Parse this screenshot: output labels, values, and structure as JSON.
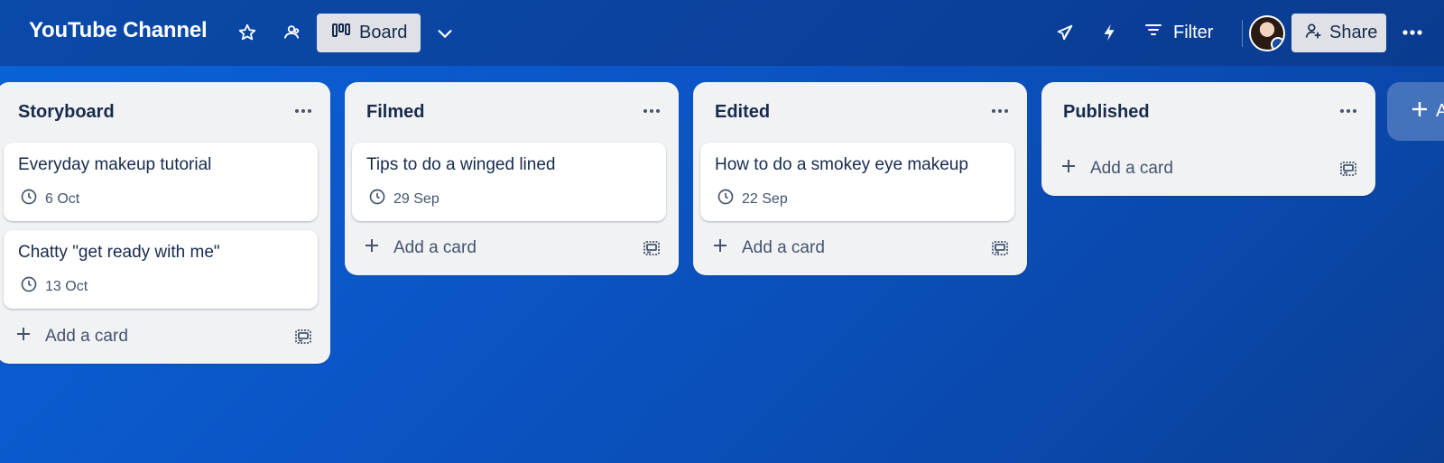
{
  "header": {
    "board_title": "YouTube Channel",
    "view_label": "Board",
    "filter_label": "Filter",
    "share_label": "Share"
  },
  "lists": [
    {
      "title": "Storyboard",
      "cards": [
        {
          "title": "Everyday makeup tutorial",
          "date": "6 Oct"
        },
        {
          "title": "Chatty \"get ready with me\"",
          "date": "13 Oct"
        }
      ],
      "add_label": "Add a card"
    },
    {
      "title": "Filmed",
      "cards": [
        {
          "title": "Tips to do a winged lined",
          "date": "29 Sep"
        }
      ],
      "add_label": "Add a card"
    },
    {
      "title": "Edited",
      "cards": [
        {
          "title": "How to do a smokey eye makeup",
          "date": "22 Sep"
        }
      ],
      "add_label": "Add a card"
    },
    {
      "title": "Published",
      "cards": [],
      "add_label": "Add a card"
    }
  ],
  "add_list_label": "A",
  "icons": {
    "star": "star-icon",
    "workspace": "workspace-visibility-icon",
    "board": "board-icon",
    "chevron": "chevron-down-icon",
    "powerups": "rocket-icon",
    "automation": "lightning-icon",
    "filter": "filter-icon",
    "share": "add-person-icon",
    "more": "more-icon",
    "clock": "clock-icon",
    "plus": "plus-icon",
    "template": "template-icon"
  },
  "colors": {
    "background": "#0b55c6",
    "list_bg": "#f1f2f4",
    "button_bg": "#dfe1e6"
  }
}
